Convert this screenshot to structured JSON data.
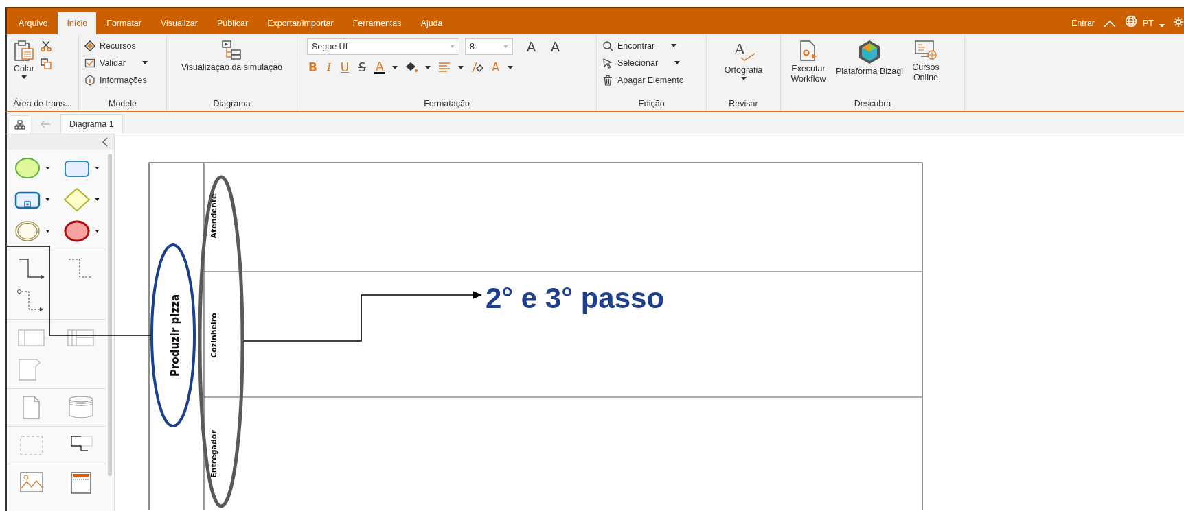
{
  "menu_tabs": [
    {
      "label": "Arquivo",
      "selected": false
    },
    {
      "label": "Início",
      "selected": true
    },
    {
      "label": "Formatar",
      "selected": false
    },
    {
      "label": "Visualizar",
      "selected": false
    },
    {
      "label": "Publicar",
      "selected": false
    },
    {
      "label": "Exportar/importar",
      "selected": false
    },
    {
      "label": "Ferramentas",
      "selected": false
    },
    {
      "label": "Ajuda",
      "selected": false
    }
  ],
  "account": {
    "sign_in": "Entrar",
    "language": "PT"
  },
  "ribbon": {
    "clipboard": {
      "label": "Área de trans...",
      "paste": "Colar"
    },
    "model": {
      "label": "Modele",
      "items": [
        "Recursos",
        "Validar",
        "Informações"
      ]
    },
    "diagram": {
      "label": "Diagrama",
      "button": "Visualização da simulação"
    },
    "format": {
      "label": "Formatação",
      "font": "Segoe UI",
      "size": "8",
      "grow": "A",
      "shrink": "A",
      "bold": "B",
      "italic": "I",
      "underline": "U",
      "strike": "S",
      "font_color": "A",
      "text_case": "A"
    },
    "editing": {
      "label": "Edição",
      "items": [
        "Encontrar",
        "Selecionar",
        "Apagar Elemento"
      ]
    },
    "review": {
      "label": "Revisar",
      "button": "Ortografia",
      "glyph": "A"
    },
    "discover": {
      "label": "Descubra",
      "buttons": [
        "Executar Workflow",
        "Plataforma Bizagi",
        "Cursos Online"
      ]
    }
  },
  "doc_tabs": [
    {
      "label": "Diagrama 1",
      "selected": true
    }
  ],
  "diagram": {
    "pool": "Produzir pizza",
    "lanes": [
      "Atendente",
      "Cozinheiro",
      "Entregador"
    ],
    "annotation": "2° e 3° passo"
  }
}
